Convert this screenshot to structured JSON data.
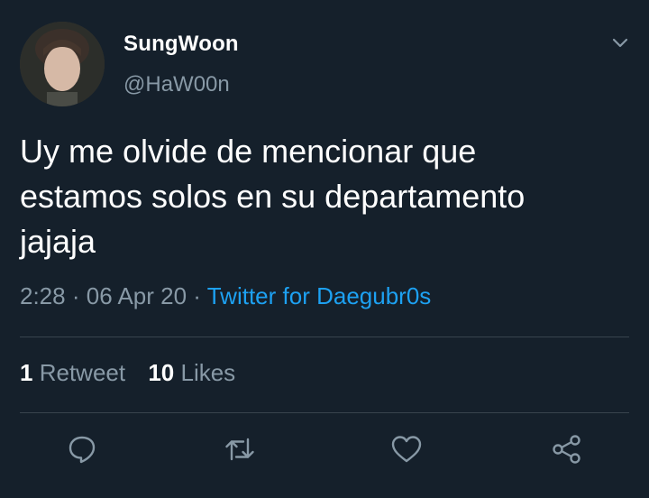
{
  "tweet": {
    "display_name": "SungWoon",
    "handle": "@HaW00n",
    "text_lines": [
      "Uy me olvide de mencionar que",
      "estamos solos en su departamento",
      "jajaja"
    ],
    "time": "2:28",
    "date": "06 Apr 20",
    "source": "Twitter for Daegubr0s",
    "separator": "·",
    "retweets": {
      "count": "1",
      "label": "Retweet"
    },
    "likes": {
      "count": "10",
      "label": "Likes"
    }
  },
  "icons": {
    "menu": "chevron-down-icon",
    "reply": "reply-icon",
    "retweet": "retweet-icon",
    "like": "heart-icon",
    "share": "share-icon"
  },
  "colors": {
    "background": "#15202b",
    "text_primary": "#ffffff",
    "text_secondary": "#8899a6",
    "link": "#1da1f2",
    "divider": "#38444d"
  }
}
